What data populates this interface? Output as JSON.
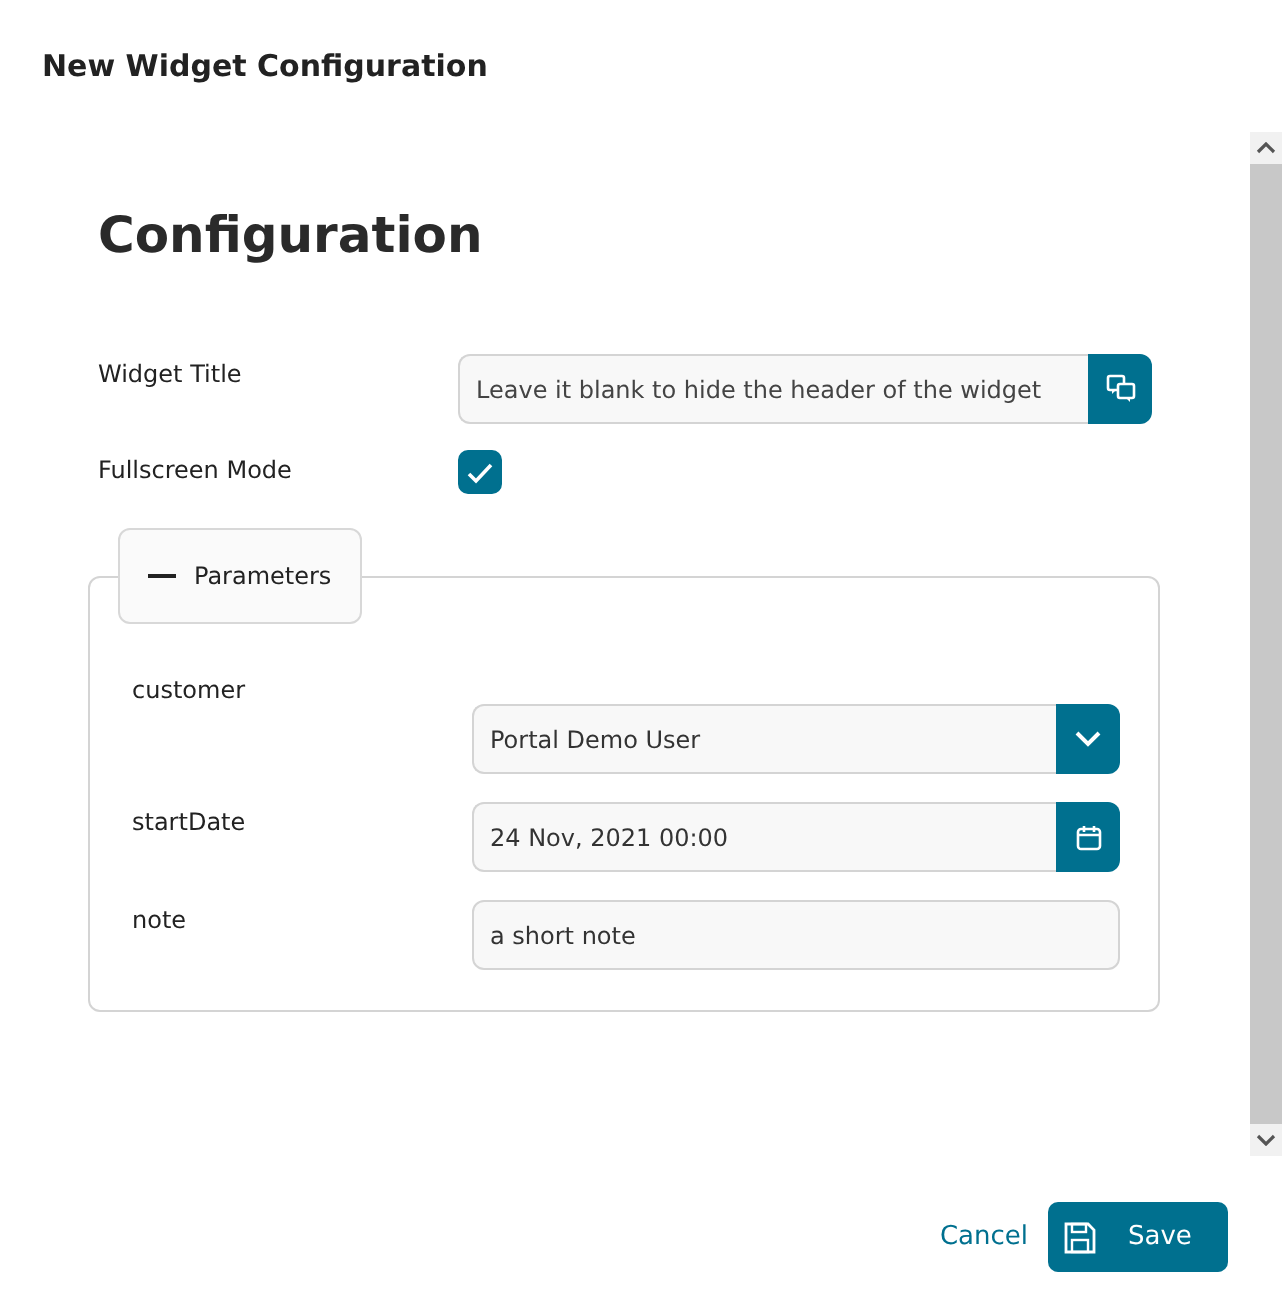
{
  "dialog": {
    "title": "New Widget Configuration"
  },
  "heading": "Configuration",
  "fields": [
    {
      "kind": "text-translate",
      "label": "Widget Title",
      "placeholder": "Leave it blank to hide the header of the widget"
    },
    {
      "kind": "checkbox",
      "label": "Fullscreen Mode",
      "checked": true
    }
  ],
  "parameters": {
    "title": "Parameters",
    "expanded": true,
    "fields": [
      {
        "kind": "select",
        "label": "customer",
        "value": "Portal Demo User"
      },
      {
        "kind": "date",
        "label": "startDate",
        "value": "24 Nov, 2021 00:00"
      },
      {
        "kind": "text",
        "label": "note",
        "value": "a short note"
      }
    ]
  },
  "buttons": [
    {
      "kind": "link",
      "label": "Cancel"
    },
    {
      "kind": "primary",
      "label": "Save"
    }
  ]
}
